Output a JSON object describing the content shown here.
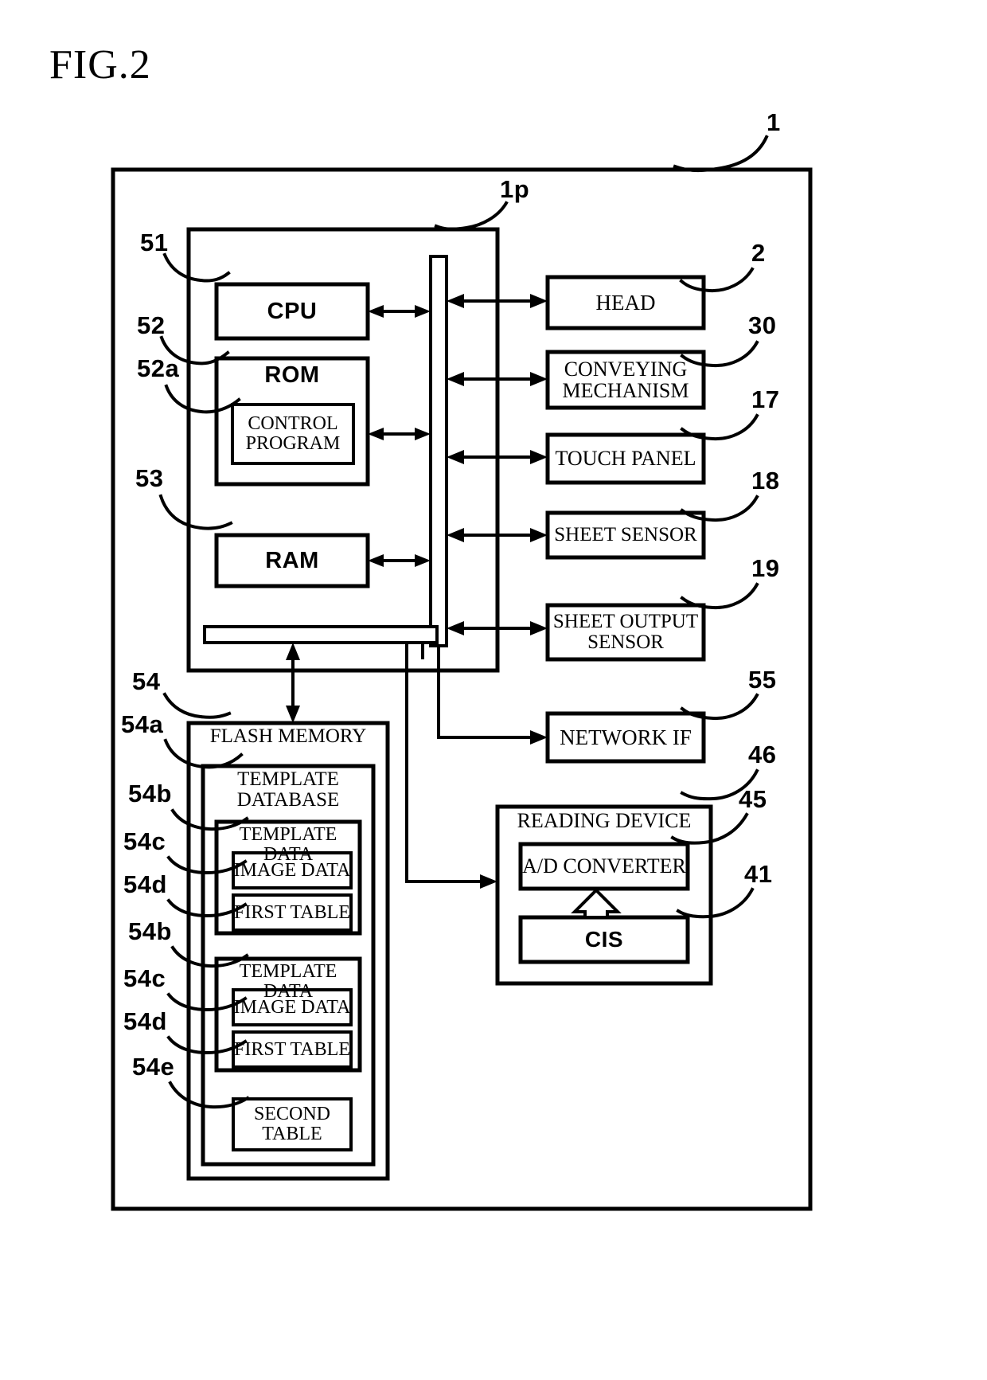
{
  "figure": {
    "title": "FIG.2",
    "type": "patent-block-diagram"
  },
  "reference_numerals": {
    "device": "1",
    "controller": "1p",
    "cpu": "51",
    "rom": "52",
    "control_program": "52a",
    "ram": "53",
    "flash_memory": "54",
    "template_database": "54a",
    "template_data_1": "54b",
    "image_data_1": "54c",
    "first_table_1": "54d",
    "template_data_2": "54b",
    "image_data_2": "54c",
    "first_table_2": "54d",
    "second_table": "54e",
    "head": "2",
    "conveying_mechanism": "30",
    "touch_panel": "17",
    "sheet_sensor": "18",
    "sheet_output_sensor": "19",
    "network_if": "55",
    "reading_device": "46",
    "ad_converter": "45",
    "cis": "41"
  },
  "blocks": {
    "cpu": "CPU",
    "rom": "ROM",
    "control_program": "CONTROL\nPROGRAM",
    "ram": "RAM",
    "flash_memory": "FLASH MEMORY",
    "template_database": "TEMPLATE\nDATABASE",
    "template_data_1": "TEMPLATE DATA",
    "image_data_1": "IMAGE DATA",
    "first_table_1": "FIRST TABLE",
    "template_data_2": "TEMPLATE DATA",
    "image_data_2": "IMAGE DATA",
    "first_table_2": "FIRST TABLE",
    "second_table": "SECOND\nTABLE",
    "head": "HEAD",
    "conveying_mechanism": "CONVEYING\nMECHANISM",
    "touch_panel": "TOUCH PANEL",
    "sheet_sensor": "SHEET SENSOR",
    "sheet_output_sensor": "SHEET OUTPUT\nSENSOR",
    "network_if": "NETWORK IF",
    "reading_device": "READING DEVICE",
    "ad_converter": "A/D CONVERTER",
    "cis": "CIS"
  },
  "colors": {
    "ink": "#000000",
    "paper": "#ffffff"
  }
}
